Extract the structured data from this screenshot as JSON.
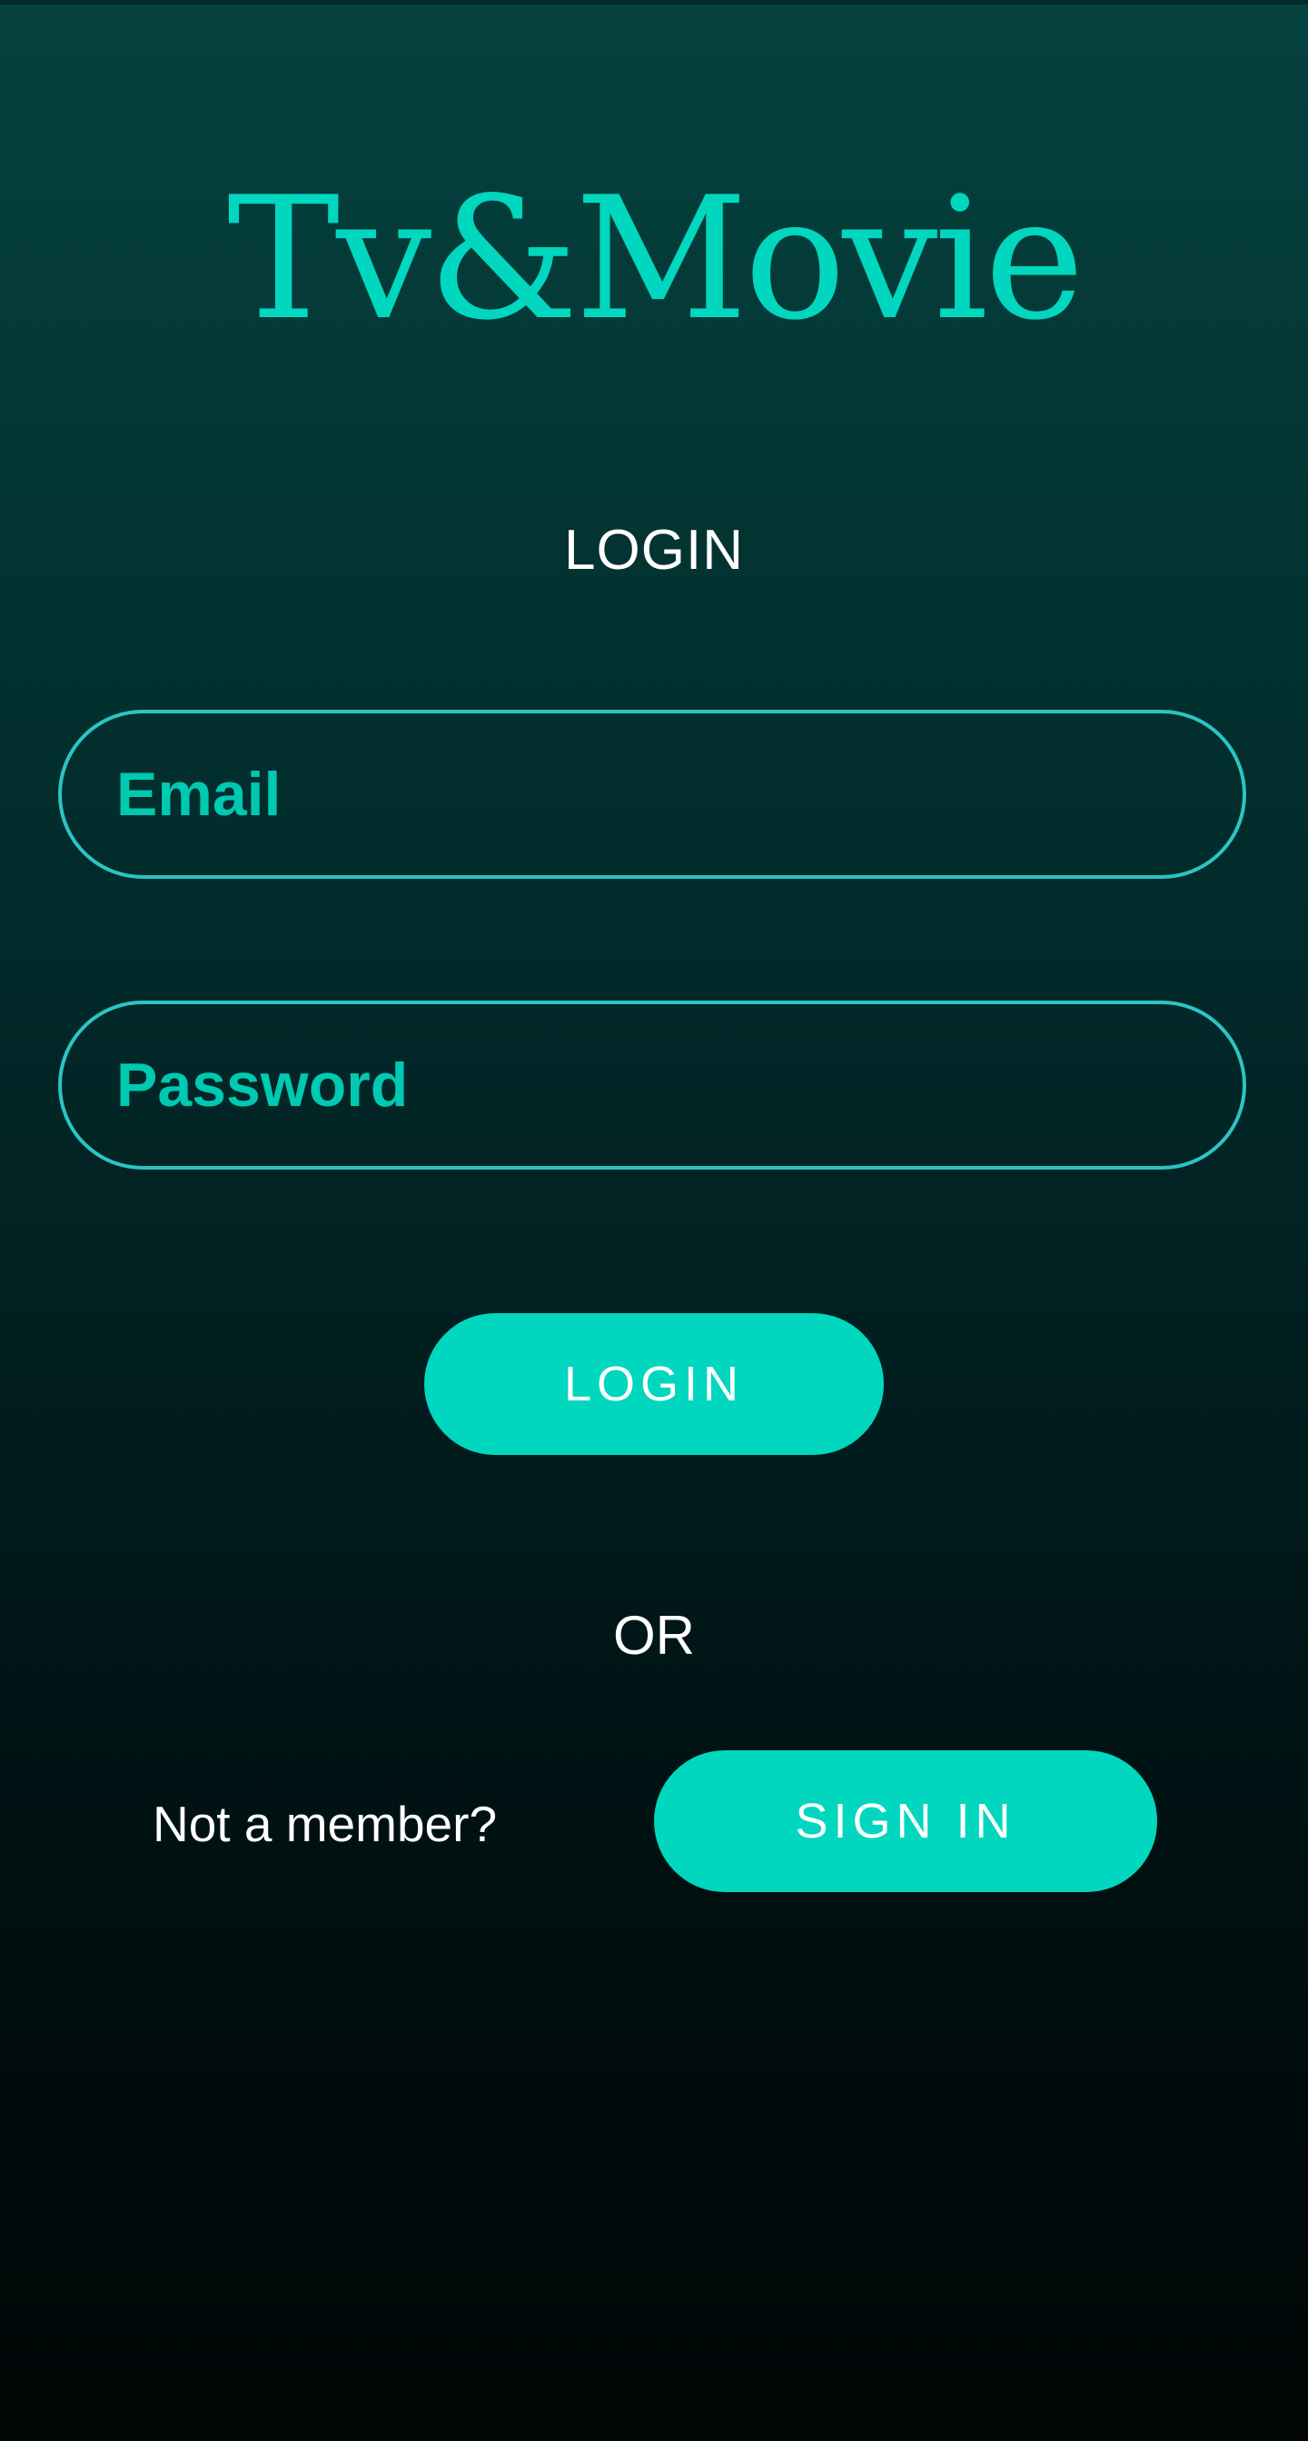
{
  "app": {
    "title": "Tv&Movie"
  },
  "form": {
    "heading": "LOGIN",
    "email_placeholder": "Email",
    "password_placeholder": "Password",
    "login_button_label": "LOGIN"
  },
  "divider": {
    "text": "OR"
  },
  "signup": {
    "prompt": "Not a member?",
    "button_label": "SIGN IN"
  },
  "colors": {
    "accent": "#00d7be",
    "field_border": "#2cc4c4",
    "text": "#ffffff"
  }
}
